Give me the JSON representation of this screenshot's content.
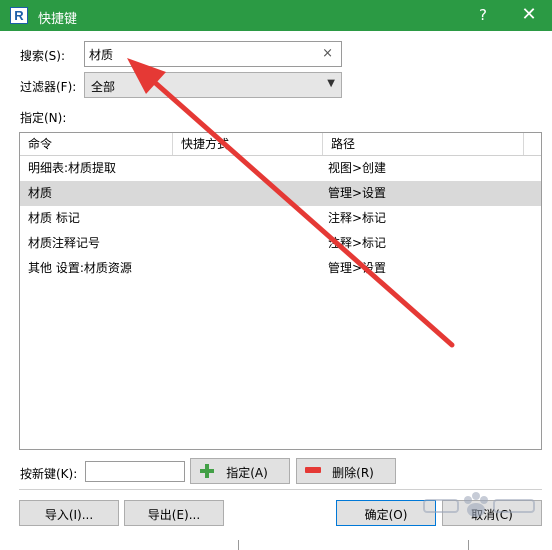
{
  "window": {
    "title": "快捷键",
    "help": "?",
    "close": "✕",
    "logo": "R"
  },
  "search": {
    "label": "搜索(S):",
    "value": "材质",
    "clear": "×"
  },
  "filter": {
    "label": "过滤器(F):",
    "value": "全部"
  },
  "assign_label": "指定(N):",
  "table": {
    "columns": [
      "命令",
      "快捷方式",
      "路径"
    ],
    "rows": [
      {
        "command": "明细表:材质提取",
        "shortcut": "",
        "path": "视图>创建",
        "selected": false
      },
      {
        "command": "材质",
        "shortcut": "",
        "path": "管理>设置",
        "selected": true
      },
      {
        "command": "材质 标记",
        "shortcut": "",
        "path": "注释>标记",
        "selected": false
      },
      {
        "command": "材质注释记号",
        "shortcut": "",
        "path": "注释>标记",
        "selected": false
      },
      {
        "command": "其他 设置:材质资源",
        "shortcut": "",
        "path": "管理>设置",
        "selected": false
      }
    ]
  },
  "newkey": {
    "label": "按新键(K):",
    "value": ""
  },
  "buttons": {
    "assign": "指定(A)",
    "remove": "删除(R)",
    "import": "导入(I)...",
    "export": "导出(E)...",
    "ok": "确定(O)",
    "cancel": "取消(C)"
  },
  "colors": {
    "titlebar": "#2b9a44",
    "selected_row": "#d9d9d9",
    "arrow": "#e53935"
  }
}
